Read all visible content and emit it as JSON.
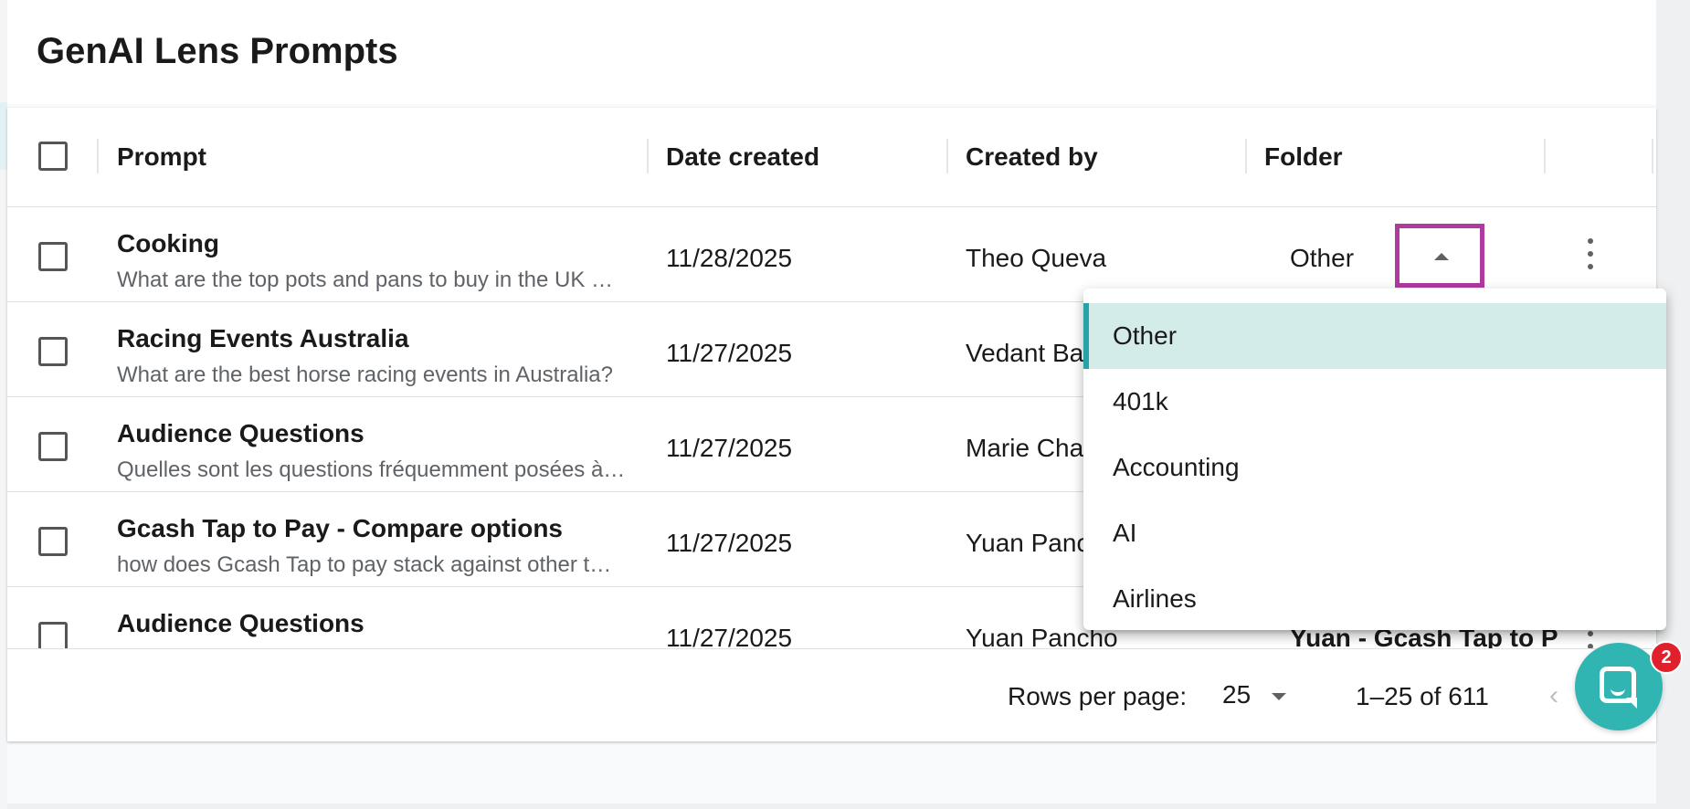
{
  "page": {
    "title": "GenAI Lens Prompts"
  },
  "table": {
    "columns": {
      "prompt": "Prompt",
      "date": "Date created",
      "creator": "Created by",
      "folder": "Folder"
    },
    "rows": [
      {
        "title": "Cooking",
        "desc": "What are the top pots and pans to buy in the UK …",
        "date": "11/28/2025",
        "creator": "Theo Queva",
        "folder": "Other"
      },
      {
        "title": "Racing Events Australia",
        "desc": "What are the best horse racing events in Australia?",
        "date": "11/27/2025",
        "creator": "Vedant Ba",
        "folder": ""
      },
      {
        "title": "Audience Questions",
        "desc": "Quelles sont les questions fréquemment posées à…",
        "date": "11/27/2025",
        "creator": "Marie Cha",
        "folder": ""
      },
      {
        "title": "Gcash Tap to Pay - Compare options",
        "desc": "how does Gcash Tap to pay stack against other t…",
        "date": "11/27/2025",
        "creator": "Yuan Panc",
        "folder": ""
      },
      {
        "title": "Audience Questions",
        "desc": "",
        "date": "11/27/2025",
        "creator": "Yuan Pancho",
        "folder": "Yuan - Gcash Tap to P"
      }
    ]
  },
  "dropdown": {
    "options": [
      "Other",
      "401k",
      "Accounting",
      "AI",
      "Airlines"
    ],
    "selected": "Other"
  },
  "footer": {
    "rows_per_page_label": "Rows per page:",
    "rows_per_page_value": "25",
    "range": "1–25 of 611",
    "prev_icon": "‹"
  },
  "chat": {
    "badge_count": "2"
  },
  "colors": {
    "accent": "#30b5b2",
    "highlight": "#b03a9e",
    "selected_bg": "#d3ecea"
  }
}
